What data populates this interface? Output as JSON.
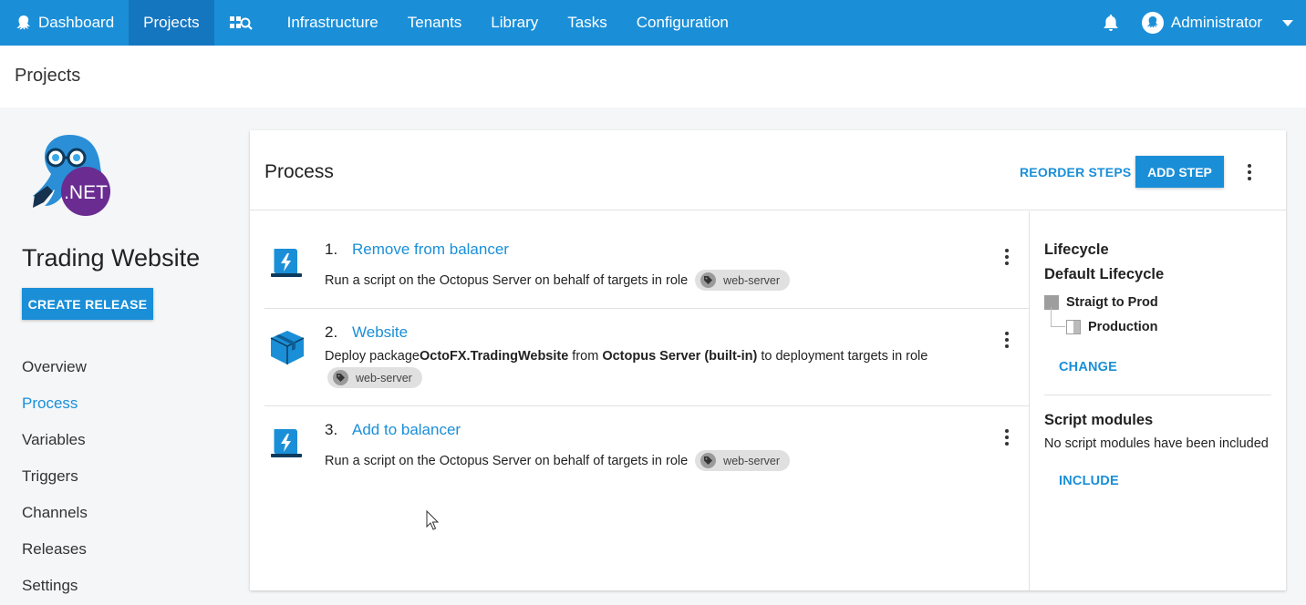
{
  "nav": {
    "items": [
      {
        "label": "Dashboard"
      },
      {
        "label": "Projects"
      },
      {
        "label": "Infrastructure"
      },
      {
        "label": "Tenants"
      },
      {
        "label": "Library"
      },
      {
        "label": "Tasks"
      },
      {
        "label": "Configuration"
      }
    ],
    "user": "Administrator"
  },
  "page_title": "Projects",
  "project": {
    "name": "Trading Website",
    "logo_text": ".NET",
    "create_release": "CREATE RELEASE",
    "nav": [
      "Overview",
      "Process",
      "Variables",
      "Triggers",
      "Channels",
      "Releases",
      "Settings"
    ],
    "active_nav": "Process"
  },
  "process": {
    "title": "Process",
    "reorder_label": "REORDER STEPS",
    "add_step_label": "ADD STEP",
    "steps": [
      {
        "number": "1.",
        "name": "Remove from balancer",
        "description": "Run a script on the Octopus Server on behalf of targets in role",
        "role": "web-server",
        "icon": "script-icon"
      },
      {
        "number": "2.",
        "name": "Website",
        "desc_prefix": "Deploy package ",
        "package": "OctoFX.TradingWebsite",
        "desc_mid": " from ",
        "feed": "Octopus Server (built-in)",
        "desc_suffix": " to deployment targets in role",
        "role": "web-server",
        "icon": "package-icon"
      },
      {
        "number": "3.",
        "name": "Add to balancer",
        "description": "Run a script on the Octopus Server on behalf of targets in role",
        "role": "web-server",
        "icon": "script-icon"
      }
    ]
  },
  "lifecycle": {
    "label": "Lifecycle",
    "name": "Default Lifecycle",
    "phases": [
      "Straigt to Prod",
      "Production"
    ],
    "change_label": "CHANGE"
  },
  "script_modules": {
    "title": "Script modules",
    "text": "No script modules have been included",
    "include_label": "INCLUDE"
  },
  "colors": {
    "accent": "#1a8fd8",
    "nav_active": "#1576c0"
  }
}
